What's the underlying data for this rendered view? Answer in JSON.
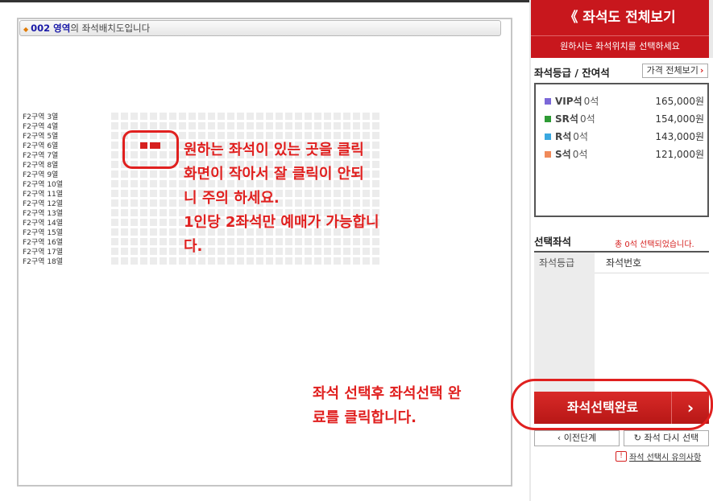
{
  "zone_bar": {
    "zone": "002 영역",
    "suffix": "의 좌석배치도입니다"
  },
  "row_labels": [
    "F2구역 3열",
    "F2구역 4열",
    "F2구역 5열",
    "F2구역 6열",
    "F2구역 7열",
    "F2구역 8열",
    "F2구역 9열",
    "F2구역 10열",
    "F2구역 11열",
    "F2구역 12열",
    "F2구역 13열",
    "F2구역 14열",
    "F2구역 15열",
    "F2구역 16열",
    "F2구역 17열",
    "F2구역 18열"
  ],
  "annotation_main": [
    "원하는 좌석이 있는 곳을 클릭",
    "화면이 작아서 잘 클릭이 안되",
    "니 주의 하세요.",
    "1인당 2좌석만 예매가 가능합니",
    "다."
  ],
  "annotation_complete": [
    "좌석 선택후 좌석선택 완",
    "료를 클릭합니다."
  ],
  "header": {
    "title": "좌석도 전체보기",
    "subtitle": "원하시는 좌석위치를 선택하세요"
  },
  "grade_section": {
    "title": "좌석등급 / 잔여석",
    "price_button": "가격 전체보기"
  },
  "grades": [
    {
      "name": "VIP석",
      "count": "0석",
      "price": "165,000원",
      "color": "#7b68d8"
    },
    {
      "name": "SR석",
      "count": "0석",
      "price": "154,000원",
      "color": "#2e9b35"
    },
    {
      "name": "R석",
      "count": "0석",
      "price": "143,000원",
      "color": "#3aa8e0"
    },
    {
      "name": "S석",
      "count": "0석",
      "price": "121,000원",
      "color": "#f08a5a"
    }
  ],
  "selected": {
    "title": "선택좌석",
    "count_text": "총 0석 선택되었습니다.",
    "col_grade": "좌석등급",
    "col_seat": "좌석번호"
  },
  "complete_button": "좌석선택완료",
  "prev_button": "이전단계",
  "reset_button": "좌석 다시 선택",
  "notice": "좌석 선택시 유의사항"
}
